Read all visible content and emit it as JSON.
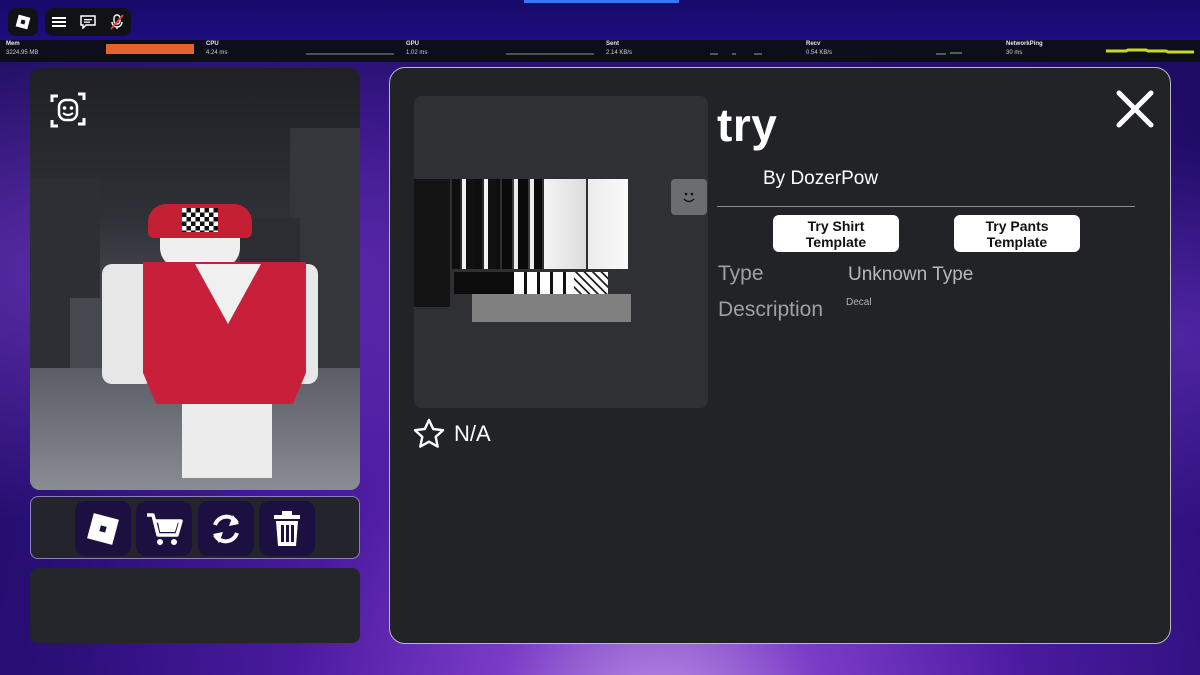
{
  "colors": {
    "top_bar": "#1d0d7e",
    "panel_bg": "#222327",
    "shirt_red": "#c8203a",
    "graph_orange": "#e5622a",
    "graph_yellow": "#c8d92a"
  },
  "top_bar": {
    "icons": [
      "roblox-logo-icon",
      "hamburger-menu-icon",
      "chat-icon",
      "microphone-muted-icon"
    ]
  },
  "stats": {
    "mem": {
      "label": "Mem",
      "value": "3224.95 MB"
    },
    "cpu": {
      "label": "CPU",
      "value": "4.24 ms"
    },
    "gpu": {
      "label": "GPU",
      "value": "1.02 ms"
    },
    "sent": {
      "label": "Sent",
      "value": "2.14 KB/s"
    },
    "recv": {
      "label": "Recv",
      "value": "0.54 KB/s"
    },
    "ping": {
      "label": "NetworkPing",
      "value": "30 ms"
    }
  },
  "avatar_panel": {
    "icons": [
      "face-tracking-icon"
    ]
  },
  "toolbar": {
    "buttons": [
      "roblox-icon",
      "cart-icon",
      "refresh-icon",
      "trash-icon"
    ]
  },
  "item": {
    "title": "try",
    "author": "By DozerPow",
    "try_shirt": "Try Shirt Template",
    "try_pants": "Try Pants Template",
    "type_label": "Type",
    "type_value": "Unknown Type",
    "description_label": "Description",
    "description_value": "Decal",
    "favorites": "N/A"
  }
}
